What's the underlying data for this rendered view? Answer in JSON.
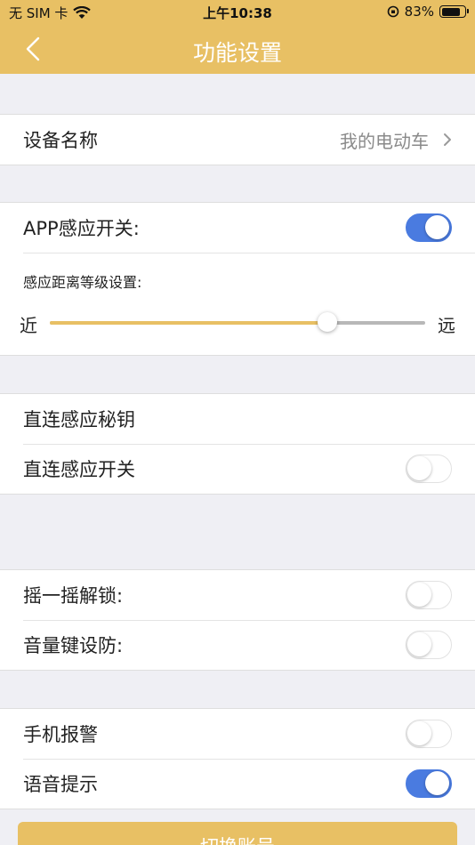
{
  "status_bar": {
    "carrier": "无 SIM 卡",
    "time": "上午10:38",
    "battery": "83%",
    "battery_level": 0.83
  },
  "header": {
    "title": "功能设置"
  },
  "device": {
    "label": "设备名称",
    "value": "我的电动车"
  },
  "app_sensing": {
    "label": "APP感应开关:",
    "on": true,
    "distance_label": "感应距离等级设置:",
    "near": "近",
    "far": "远",
    "distance_level": 0.74
  },
  "direct": {
    "key_label": "直连感应秘钥",
    "switch_label": "直连感应开关",
    "switch_on": false
  },
  "shake": {
    "label": "摇一摇解锁:",
    "on": false
  },
  "volume_key": {
    "label": "音量键设防:",
    "on": false
  },
  "phone_alarm": {
    "label": "手机报警",
    "on": false
  },
  "voice_prompt": {
    "label": "语音提示",
    "on": true
  },
  "footer": {
    "switch_account": "切换账号"
  },
  "colors": {
    "accent": "#e8c064",
    "toggle_on": "#4a7be0",
    "background": "#efeff4"
  }
}
